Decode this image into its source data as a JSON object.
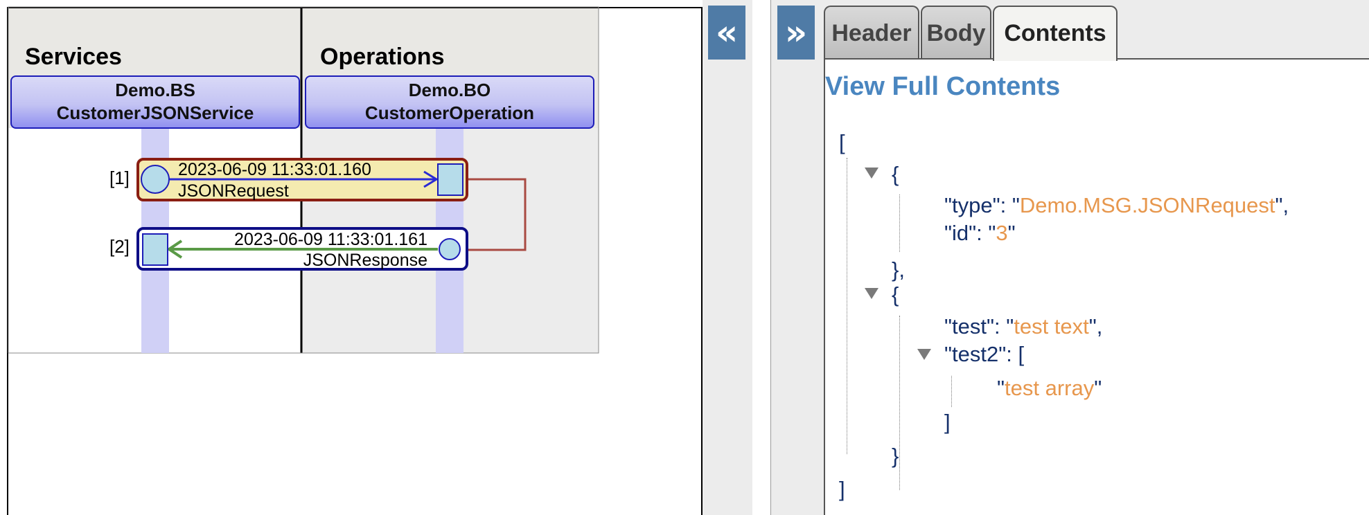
{
  "diagram": {
    "columns": [
      {
        "title": "Services",
        "box_line1": "Demo.BS",
        "box_line2": "CustomerJSONService"
      },
      {
        "title": "Operations",
        "box_line1": "Demo.BO",
        "box_line2": "CustomerOperation"
      }
    ],
    "messages": [
      {
        "index": "[1]",
        "timestamp": "2023-06-09 11:33:01.160",
        "name": "JSONRequest"
      },
      {
        "index": "[2]",
        "timestamp": "2023-06-09 11:33:01.161",
        "name": "JSONResponse"
      }
    ],
    "colors": {
      "request_border": "#8a1e12",
      "request_fill": "#f4ebb0",
      "response_border": "#0e0e86",
      "request_arrow": "#2a2ad4",
      "response_arrow": "#5a9a47",
      "lifeline": "#d0d0f6",
      "connector": "#a94a42"
    }
  },
  "controls": {
    "collapse_left": "«",
    "expand_right": "»"
  },
  "tabs": [
    {
      "label": "Header",
      "active": false
    },
    {
      "label": "Body",
      "active": false
    },
    {
      "label": "Contents",
      "active": true
    }
  ],
  "contents": {
    "view_full_link": "View Full Contents",
    "json": {
      "open_array": "[",
      "obj1_open": "{",
      "type_key": "\"type\": \"",
      "type_val": "Demo.MSG.JSONRequest",
      "type_end": "\",",
      "id_key": "\"id\": \"",
      "id_val": "3",
      "id_end": "\"",
      "obj1_close": "},",
      "obj2_open": "{",
      "test_key": "\"test\": \"",
      "test_val": "test text",
      "test_end": "\",",
      "test2_key": "\"test2\": [",
      "arr_quote_open": "\"",
      "arr_val": "test array",
      "arr_quote_close": "\"",
      "arr_close": "]",
      "obj2_close": "}",
      "close_array": "]"
    }
  }
}
